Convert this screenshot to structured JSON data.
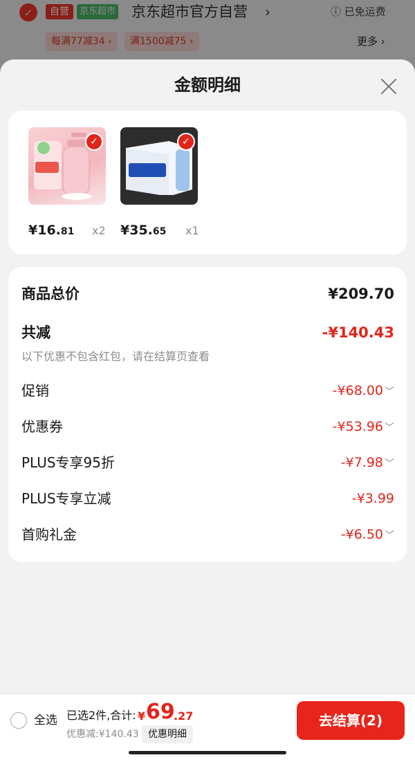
{
  "store": {
    "tag_self": "自营",
    "tag_super": "京东超市",
    "name": "京东超市官方自营",
    "chevron": "›",
    "free_shipping": "ⓘ 已免运费",
    "promos": [
      "每满77减34 ›",
      "满1500减75 ›"
    ],
    "more": "更多 ›"
  },
  "sheet": {
    "title": "金额明细",
    "products": [
      {
        "price_int": "¥16.",
        "price_dec": "81",
        "qty": "x2",
        "check": "✓"
      },
      {
        "price_int": "¥35.",
        "price_dec": "65",
        "qty": "x1",
        "check": "✓"
      }
    ],
    "rows": {
      "total_label": "商品总价",
      "total_value": "¥209.70",
      "reduce_label": "共减",
      "reduce_value": "-¥140.43",
      "reduce_note": "以下优惠不包含红包，请在结算页查看",
      "promo_label": "促销",
      "promo_value": "-¥68.00",
      "coupon_label": "优惠券",
      "coupon_value": "-¥53.96",
      "plus95_label": "PLUS专享95折",
      "plus95_value": "-¥7.98",
      "plusreduce_label": "PLUS专享立减",
      "plusreduce_value": "-¥3.99",
      "firstbuy_label": "首购礼金",
      "firstbuy_value": "-¥6.50",
      "chevron": "﹀"
    }
  },
  "bottom": {
    "select_all": "全选",
    "selected": "已选2件,合计:",
    "total_yen": "¥",
    "total_int": "69",
    "total_dec": ".27",
    "discount": "优惠减:¥140.43",
    "detail_btn": "优惠明细",
    "checkout": "去结算(2)"
  },
  "colors": {
    "accent": "#e1251b",
    "background": "#f2f2f2",
    "card": "#ffffff"
  }
}
